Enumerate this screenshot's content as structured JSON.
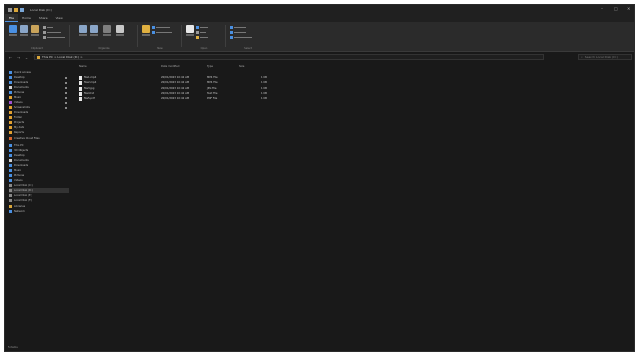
{
  "window": {
    "title": "Local Disk (D:)"
  },
  "tabs": [
    "File",
    "Home",
    "Share",
    "View"
  ],
  "ribbon": {
    "groups": [
      "Clipboard",
      "Organize",
      "New",
      "Open",
      "Select"
    ],
    "buttons": {
      "pin": "Pin to Quick access",
      "copy": "Copy",
      "paste": "Paste",
      "cut": "Cut",
      "copy_path": "Copy path",
      "paste_shortcut": "Paste shortcut",
      "move_to": "Move to",
      "copy_to": "Copy to",
      "delete": "Delete",
      "rename": "Rename",
      "new_folder": "New folder",
      "new_item": "New item",
      "easy_access": "Easy access",
      "properties": "Properties",
      "open": "Open",
      "edit": "Edit",
      "history": "History",
      "select_all": "Select all",
      "select_none": "Select none",
      "invert_selection": "Invert selection"
    }
  },
  "address": {
    "path": "This PC  >  Local Disk (D:)  >  "
  },
  "search": {
    "placeholder": "Search Local Disk (D:)"
  },
  "nav": {
    "items": [
      {
        "label": "Quick access",
        "color": "#4a90e2"
      },
      {
        "label": "Desktop",
        "color": "#4a90e2"
      },
      {
        "label": "Downloads",
        "color": "#4a90e2"
      },
      {
        "label": "Documents",
        "color": "#d0d0d0"
      },
      {
        "label": "Pictures",
        "color": "#4a90e2"
      },
      {
        "label": "Music",
        "color": "#e0a030"
      },
      {
        "label": "Videos",
        "color": "#a050d0"
      },
      {
        "label": "Screenshots",
        "color": "#e0a030"
      },
      {
        "label": "Downloads",
        "color": "#e0a030"
      },
      {
        "label": "Folder",
        "color": "#e0a030"
      },
      {
        "label": "Projects",
        "color": "#e0a030"
      },
      {
        "label": "My data",
        "color": "#e0a030"
      },
      {
        "label": "Reports",
        "color": "#e0a030"
      },
      {
        "label": "Creative Cloud Files",
        "color": "#d8632c"
      },
      {
        "label": "This PC",
        "color": "#4a90e2"
      },
      {
        "label": "3D Objects",
        "color": "#4a90e2"
      },
      {
        "label": "Desktop",
        "color": "#4a90e2"
      },
      {
        "label": "Documents",
        "color": "#d0d0d0"
      },
      {
        "label": "Downloads",
        "color": "#4a90e2"
      },
      {
        "label": "Music",
        "color": "#4a90e2"
      },
      {
        "label": "Pictures",
        "color": "#4a90e2"
      },
      {
        "label": "Videos",
        "color": "#4a90e2"
      },
      {
        "label": "Local Disk (C:)",
        "color": "#888888"
      },
      {
        "label": "Local Disk (D:)",
        "color": "#888888"
      },
      {
        "label": "Local Disk (E:)",
        "color": "#888888"
      },
      {
        "label": "Local Disk (F:)",
        "color": "#888888"
      },
      {
        "label": "Libraries",
        "color": "#d9a63a"
      },
      {
        "label": "Network",
        "color": "#4a90e2"
      }
    ]
  },
  "list": {
    "columns": [
      "Name",
      "Date modified",
      "Type",
      "Size"
    ],
    "rows": [
      {
        "name": "file1.mp4",
        "date": "20/01/2023 10:42 AM",
        "type": "MP4 File",
        "size": "1 KB"
      },
      {
        "name": "file2.mp4",
        "date": "20/01/2023 10:42 AM",
        "type": "MP4 File",
        "size": "1 KB"
      },
      {
        "name": "file3.jpg",
        "date": "20/01/2023 10:42 AM",
        "type": "JPG File",
        "size": "1 KB"
      },
      {
        "name": "file4.txt",
        "date": "20/01/2023 10:42 AM",
        "type": "Text File",
        "size": "1 KB"
      },
      {
        "name": "file5.pdf",
        "date": "20/01/2023 10:42 AM",
        "type": "PDF File",
        "size": "1 KB"
      }
    ]
  },
  "status": {
    "text": "5 items"
  }
}
